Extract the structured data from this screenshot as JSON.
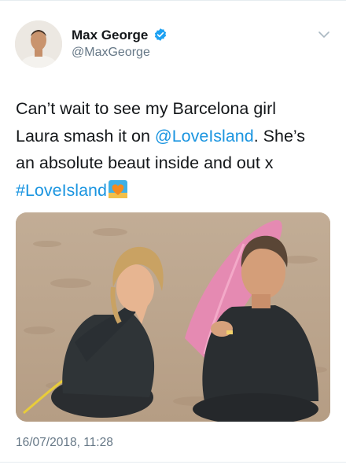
{
  "tweet": {
    "author": {
      "display_name": "Max George",
      "handle": "@MaxGeorge",
      "verified": true,
      "avatar_icon": "profile-photo"
    },
    "text_parts": {
      "line1": "Can’t wait to see my Barcelona girl",
      "line2_pre": "Laura smash it on ",
      "mention": "@LoveIsland",
      "line2_post": ". She’s",
      "line3": "an absolute beaut inside and out x",
      "hashtag": "#LoveIsland",
      "emoji": "orange-heart-hashflag"
    },
    "photo": {
      "description_icon": "tweet-photo"
    },
    "timestamp": "16/07/2018, 11:28"
  },
  "colors": {
    "link": "#1b95e0",
    "verified": "#1da1f2",
    "muted": "#657786",
    "text": "#14171a"
  }
}
